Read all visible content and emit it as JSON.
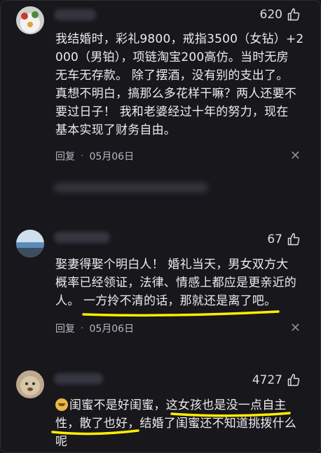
{
  "colors": {
    "background": "#17171c",
    "highlight": "#ffee00"
  },
  "comments": [
    {
      "likes": "620",
      "text_lines": [
        "我结婚时，彩礼9800，戒指3500（女钻）+2",
        "000（男铂），项链淘宝200高仿。当时无房",
        "无车无存款。 除了摆酒，没有别的支出了。",
        "真想不明白，搞那么多花样干嘛？两人还要不",
        "要过日子！ 我和老婆经过十年的努力，现在",
        "基本实现了财务自由。"
      ],
      "reply": "回复",
      "date": "05月06日"
    },
    {
      "likes": "67",
      "text_lines": [
        "娶妻得娶个明白人！ 婚礼当天，男女双方大",
        "概率已经领证，法律、情感上都应是更亲近的",
        "人。 一方拎不清的话，那就还是离了吧。"
      ],
      "reply": "回复",
      "date": "05月06日"
    },
    {
      "likes": "4727",
      "text_lines": [
        "闺蜜不是好闺蜜，这女孩也是没一点自主",
        "性，散了也好，结婚了闺蜜还不知道挑拨什么",
        "呢"
      ]
    }
  ],
  "icons": {
    "like": "thumbs-up-icon",
    "close": "close-icon",
    "emoji": "doge-emoji-icon"
  }
}
